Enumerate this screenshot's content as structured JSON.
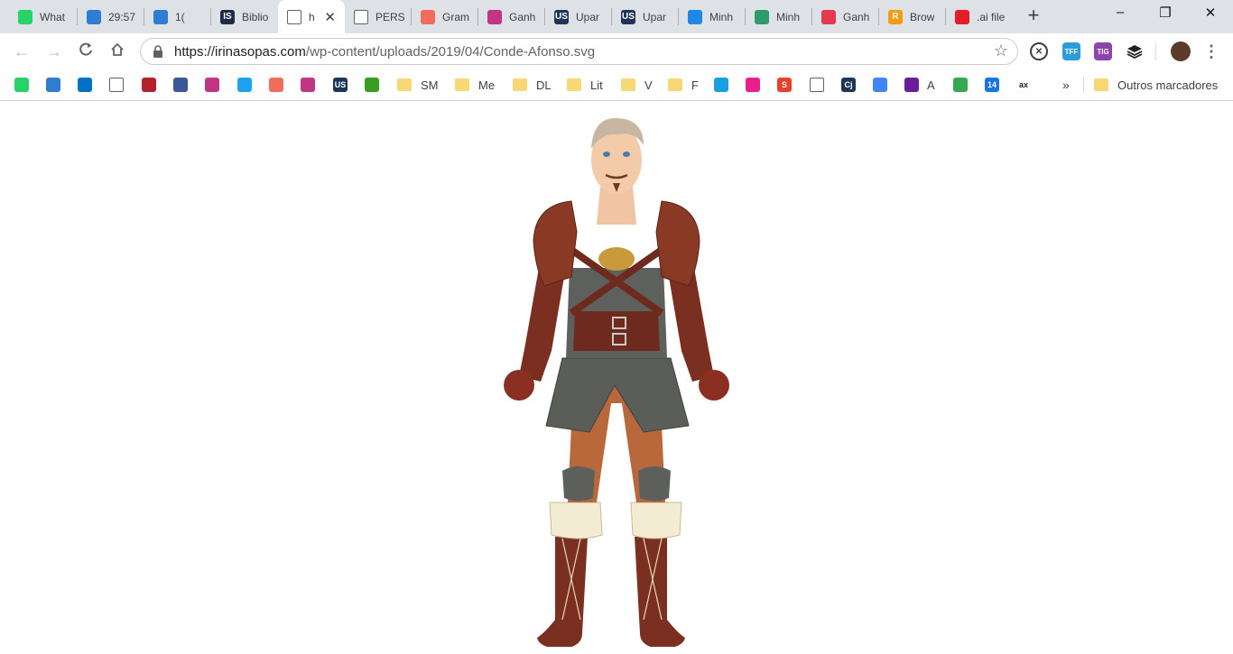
{
  "tabs": [
    {
      "title": "What",
      "icon": "whatsapp-icon",
      "color": "#25d366"
    },
    {
      "title": "29:57",
      "icon": "check-icon",
      "color": "#2f7cd3"
    },
    {
      "title": "1(",
      "icon": "check-icon",
      "color": "#2f7cd3"
    },
    {
      "title": "Biblio",
      "icon": "is-logo-icon",
      "color": "#1d2b45"
    },
    {
      "title": "h",
      "icon": "page-icon",
      "color": "#5f6368"
    },
    {
      "title": "PERS",
      "icon": "page-icon",
      "color": "#5f6368"
    },
    {
      "title": "Gram",
      "icon": "grammarly-icon",
      "color": "#f26b5b"
    },
    {
      "title": "Ganh",
      "icon": "instagram-icon",
      "color": "#c13584"
    },
    {
      "title": "Upar",
      "icon": "us-logo-icon",
      "color": "#1d3557"
    },
    {
      "title": "Upar",
      "icon": "us-logo-icon",
      "color": "#1d3557"
    },
    {
      "title": "Minh",
      "icon": "instagram-icon",
      "color": "#1e88e5"
    },
    {
      "title": "Minh",
      "icon": "instagram-icon",
      "color": "#2e9b6b"
    },
    {
      "title": "Ganh",
      "icon": "plus-cross-icon",
      "color": "#e53950"
    },
    {
      "title": "Brow",
      "icon": "r-logo-icon",
      "color": "#f39c12"
    },
    {
      "title": ".ai file",
      "icon": "adobe-icon",
      "color": "#e41e26"
    }
  ],
  "active_tab_index": 4,
  "window_controls": {
    "minimize": "–",
    "restore": "❐",
    "close": "✕"
  },
  "toolbar": {
    "url_host": "https://irinasopas.com",
    "url_path": "/wp-content/uploads/2019/04/Conde-Afonso.svg",
    "extensions": [
      {
        "icon": "close-circle-icon",
        "label": "",
        "color": "#3c4043"
      },
      {
        "icon": "tff-extension-icon",
        "label": "TFF",
        "color": "#2d9cdb"
      },
      {
        "icon": "tig-extension-icon",
        "label": "TIG",
        "color": "#8e44ad"
      },
      {
        "icon": "layers-icon",
        "label": "",
        "color": "#202124"
      }
    ]
  },
  "bookmarks": [
    {
      "label": "",
      "icon": "whatsapp-icon",
      "color": "#25d366"
    },
    {
      "label": "",
      "icon": "check-icon",
      "color": "#2f7cd3"
    },
    {
      "label": "",
      "icon": "outlook-icon",
      "color": "#0072c6"
    },
    {
      "label": "",
      "icon": "page-icon",
      "color": "#5f6368"
    },
    {
      "label": "",
      "icon": "red-logo-icon",
      "color": "#b3212a"
    },
    {
      "label": "",
      "icon": "facebook-icon",
      "color": "#3b5998"
    },
    {
      "label": "",
      "icon": "instagram-icon",
      "color": "#c13584"
    },
    {
      "label": "",
      "icon": "twitter-icon",
      "color": "#1da1f2"
    },
    {
      "label": "",
      "icon": "grammarly-icon",
      "color": "#f26b5b"
    },
    {
      "label": "",
      "icon": "instagram-icon",
      "color": "#c13584"
    },
    {
      "label": "",
      "icon": "us-logo-icon",
      "color": "#1d3557"
    },
    {
      "label": "",
      "icon": "brazil-flag-icon",
      "color": "#3a9d23"
    },
    {
      "label": "SM",
      "icon": "folder-icon",
      "color": "#f8d775"
    },
    {
      "label": "Me",
      "icon": "folder-icon",
      "color": "#f8d775"
    },
    {
      "label": "DL",
      "icon": "folder-icon",
      "color": "#f8d775"
    },
    {
      "label": "Lit",
      "icon": "folder-icon",
      "color": "#f8d775"
    },
    {
      "label": "V",
      "icon": "folder-icon",
      "color": "#f8d775"
    },
    {
      "label": "F",
      "icon": "folder-icon",
      "color": "#f8d775"
    },
    {
      "label": "",
      "icon": "translate-x-icon",
      "color": "#1aa0e0"
    },
    {
      "label": "",
      "icon": "pink-logo-icon",
      "color": "#e91e8c"
    },
    {
      "label": "",
      "icon": "s-logo-icon",
      "color": "#e8402b"
    },
    {
      "label": "",
      "icon": "page-icon",
      "color": "#5f6368"
    },
    {
      "label": "",
      "icon": "cj-logo-icon",
      "color": "#1d3557"
    },
    {
      "label": "",
      "icon": "google-translate-icon",
      "color": "#4285f4"
    },
    {
      "label": "A",
      "icon": "purple-square-icon",
      "color": "#6a1b9a"
    },
    {
      "label": "",
      "icon": "google-maps-icon",
      "color": "#34a853"
    },
    {
      "label": "",
      "icon": "calendar-14-icon",
      "color": "#1a73e8"
    },
    {
      "label": "",
      "icon": "ax-logo-icon",
      "color": "#202124"
    }
  ],
  "bookmarks_overflow": "»",
  "other_bookmarks": "Outros marcadores",
  "icon_texts": {
    "is": "IS",
    "us": "US",
    "r": "R",
    "tff": "TFF",
    "tig": "TIG",
    "cj": "Cj",
    "s": "S",
    "cal": "14",
    "ax": "ax"
  }
}
